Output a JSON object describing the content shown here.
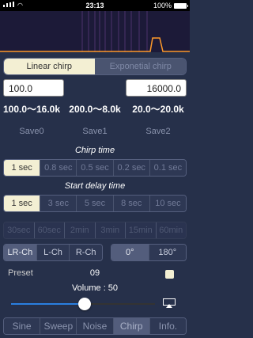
{
  "status": {
    "time": "23:13",
    "battery": "100%"
  },
  "mode": {
    "options": [
      "Linear chirp",
      "Exponetial chirp"
    ],
    "active_index": 0
  },
  "freq": {
    "start": "100.0",
    "end": "16000.0"
  },
  "presets": {
    "ranges": [
      "100.0～16.0k",
      "200.0～8.0k",
      "20.0～20.0k"
    ],
    "saves": [
      "Save0",
      "Save1",
      "Save2"
    ]
  },
  "chirp_time": {
    "label": "Chirp time",
    "options": [
      "1 sec",
      "0.8 sec",
      "0.5 sec",
      "0.2 sec",
      "0.1 sec"
    ],
    "active_index": 0
  },
  "start_delay": {
    "label": "Start delay time",
    "options": [
      "1 sec",
      "3 sec",
      "5 sec",
      "8 sec",
      "10 sec"
    ],
    "active_index": 0
  },
  "duration": {
    "options": [
      "30sec",
      "60sec",
      "2min",
      "3min",
      "15min",
      "60min"
    ]
  },
  "channel": {
    "options": [
      "LR-Ch",
      "L-Ch",
      "R-Ch"
    ],
    "active_index": 0
  },
  "phase": {
    "options": [
      "0°",
      "180°"
    ],
    "active_index": 0
  },
  "preset": {
    "label": "Preset",
    "value": "09"
  },
  "volume": {
    "label": "Volume : 50",
    "level": 0.5
  },
  "tabs": {
    "options": [
      "Sine",
      "Sweep",
      "Noise",
      "Chirp",
      "Info."
    ],
    "active_index": 3
  }
}
